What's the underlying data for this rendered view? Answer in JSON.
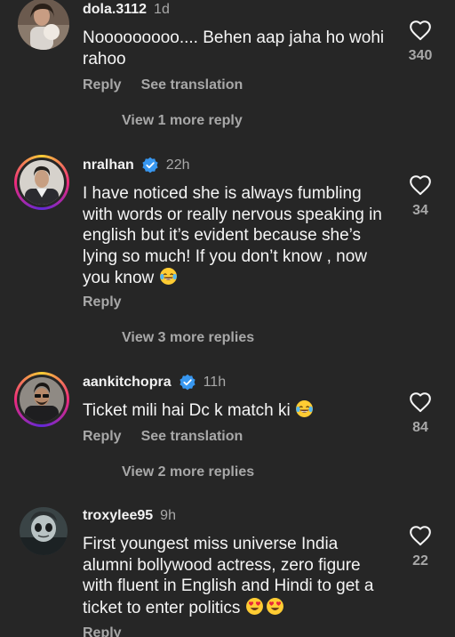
{
  "colors": {
    "background": "#262626",
    "primary_text": "#f5f5f5",
    "secondary_text": "#a8a8a8",
    "verified_badge": "#3897f0",
    "story_ring": [
      "#f9ce34",
      "#ee2a7b",
      "#6228d7"
    ]
  },
  "comments": [
    {
      "username": "dola.3112",
      "time": "1d",
      "verified": false,
      "text": "Nooooooooo.... Behen aap jaha ho wohi rahoo",
      "likes": "340",
      "actions": [
        "Reply",
        "See translation"
      ],
      "more_replies": "View 1 more reply"
    },
    {
      "username": "nralhan",
      "time": "22h",
      "verified": true,
      "text": "I have noticed she is always fumbling with words or really nervous speaking  in  english but it’s evident because she’s lying so much!  If you don’t know , now you know",
      "emoji": "face-with-tears-of-joy",
      "likes": "34",
      "actions": [
        "Reply"
      ],
      "more_replies": "View 3 more replies"
    },
    {
      "username": "aankitchopra",
      "time": "11h",
      "verified": true,
      "text": "Ticket mili hai Dc k match ki",
      "emoji": "face-with-tears-of-joy",
      "likes": "84",
      "actions": [
        "Reply",
        "See translation"
      ],
      "more_replies": "View 2 more replies"
    },
    {
      "username": "troxylee95",
      "time": "9h",
      "verified": false,
      "text": "First youngest miss universe India alumni bollywood actress, zero figure with fluent in English and Hindi to get a ticket to enter politics",
      "emoji": "smiling-face-with-heart-eyes x2",
      "likes": "22",
      "actions": [
        "Reply"
      ]
    }
  ],
  "icons": {
    "like": "heart-outline-icon",
    "verified": "verified-badge-icon"
  }
}
